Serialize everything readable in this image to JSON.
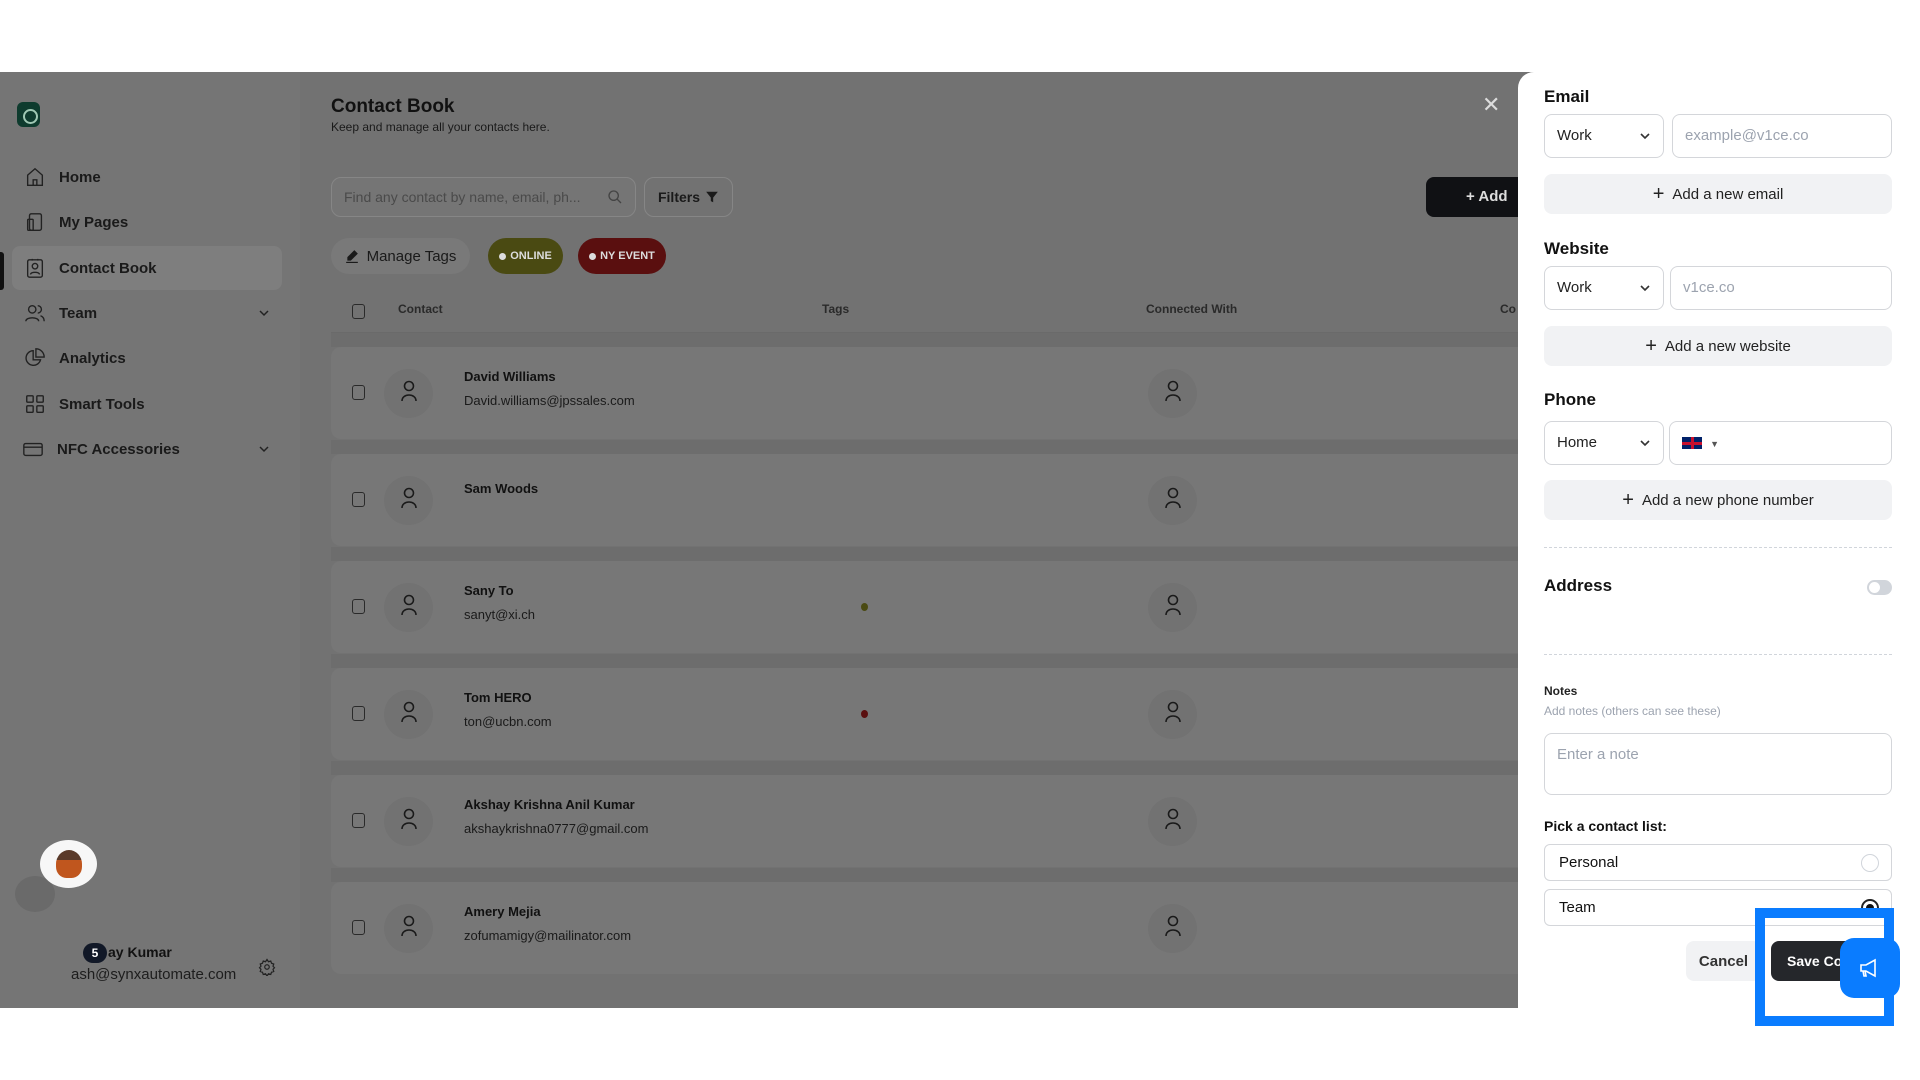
{
  "sidebar": {
    "items": [
      {
        "label": "Home",
        "icon": "home-icon"
      },
      {
        "label": "My Pages",
        "icon": "pages-icon"
      },
      {
        "label": "Contact Book",
        "icon": "contact-book-icon",
        "active": true
      },
      {
        "label": "Team",
        "icon": "team-icon",
        "expandable": true
      },
      {
        "label": "Analytics",
        "icon": "analytics-icon"
      },
      {
        "label": "Smart Tools",
        "icon": "grid-icon"
      },
      {
        "label": "NFC Accessories",
        "icon": "card-icon",
        "expandable": true
      }
    ],
    "user": {
      "name": "ay Kumar",
      "email": "ash@synxautomate.com",
      "notification_count": "5"
    }
  },
  "main": {
    "title": "Contact Book",
    "subtitle": "Keep and manage all your contacts here.",
    "search_placeholder": "Find any contact by name, email, ph...",
    "filters_label": "Filters",
    "add_label": "+ Add",
    "manage_tags_label": "Manage Tags",
    "tags": [
      {
        "label": "ONLINE",
        "color": "#4a4a12"
      },
      {
        "label": "NY EVENT",
        "color": "#5a0f0f"
      }
    ],
    "columns": [
      "Contact",
      "Tags",
      "Connected With",
      "Co"
    ],
    "rows": [
      {
        "name": "David Williams",
        "email": "David.williams@jpssales.com",
        "tag_color": null
      },
      {
        "name": "Sam Woods",
        "email": "",
        "tag_color": null
      },
      {
        "name": "Sany To",
        "email": "sanyt@xi.ch",
        "tag_color": "#4a4a12"
      },
      {
        "name": "Tom HERO",
        "email": "ton@ucbn.com",
        "tag_color": "#5a0f0f"
      },
      {
        "name": "Akshay Krishna Anil Kumar",
        "email": "akshaykrishna0777@gmail.com",
        "tag_color": null
      },
      {
        "name": "Amery Mejia",
        "email": "zofumamigy@mailinator.com",
        "tag_color": null
      }
    ]
  },
  "panel": {
    "email": {
      "label": "Email",
      "type": "Work",
      "placeholder": "example@v1ce.co",
      "add_label": "Add a new email"
    },
    "website": {
      "label": "Website",
      "type": "Work",
      "placeholder": "v1ce.co",
      "add_label": "Add a new website"
    },
    "phone": {
      "label": "Phone",
      "type": "Home",
      "country": "GB",
      "add_label": "Add a new phone number"
    },
    "address": {
      "label": "Address",
      "enabled": false
    },
    "notes": {
      "label": "Notes",
      "hint": "Add notes (others can see these)",
      "placeholder": "Enter a note"
    },
    "contact_list": {
      "label": "Pick a contact list:",
      "options": [
        "Personal",
        "Team"
      ],
      "selected": "Team"
    },
    "cancel_label": "Cancel",
    "save_label": "Save Co"
  },
  "colors": {
    "highlight": "#0a7cff",
    "primary_button": "#25272b"
  }
}
